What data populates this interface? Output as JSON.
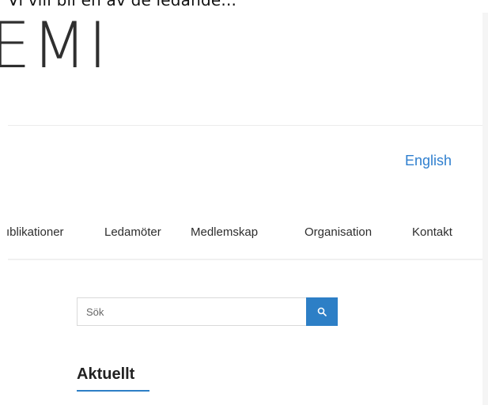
{
  "top_text": "Vi vill bli en av de ledande...",
  "logo": {
    "text": "EMI"
  },
  "language_link": "English",
  "nav": {
    "items": [
      {
        "label": "ıblikationer"
      },
      {
        "label": "Ledamöter"
      },
      {
        "label": "Medlemskap"
      },
      {
        "label": "Organisation"
      },
      {
        "label": "Kontakt"
      }
    ]
  },
  "search": {
    "placeholder": "Sök",
    "button_icon": "search-icon"
  },
  "section": {
    "heading": "Aktuellt"
  },
  "colors": {
    "accent": "#2d7fc6",
    "link": "#2f7fcf"
  }
}
